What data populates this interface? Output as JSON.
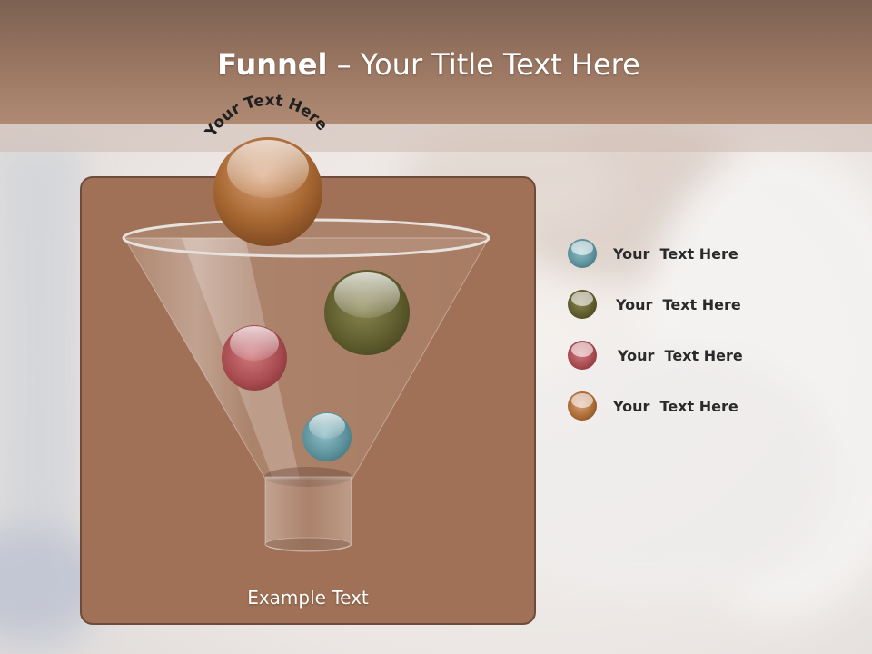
{
  "slide": {
    "title_bold": "Funnel",
    "title_rest": " – Your Title Text Here",
    "top_label": "Your Text Here",
    "funnel_caption": "Example Text"
  },
  "legend": [
    {
      "label": "Your  Text Here",
      "color": "#5a8f99"
    },
    {
      "label": "Your  Text Here",
      "color": "#5c5a2c"
    },
    {
      "label": "Your  Text Here",
      "color": "#a5494e"
    },
    {
      "label": "Your  Text Here",
      "color": "#a86832"
    }
  ],
  "colors": {
    "title_band": "#96735f",
    "panel": "#a07156",
    "ball_top": "#a86832",
    "ball_olive": "#5c5a2c",
    "ball_red": "#a5494e",
    "ball_teal": "#5a8f99"
  }
}
